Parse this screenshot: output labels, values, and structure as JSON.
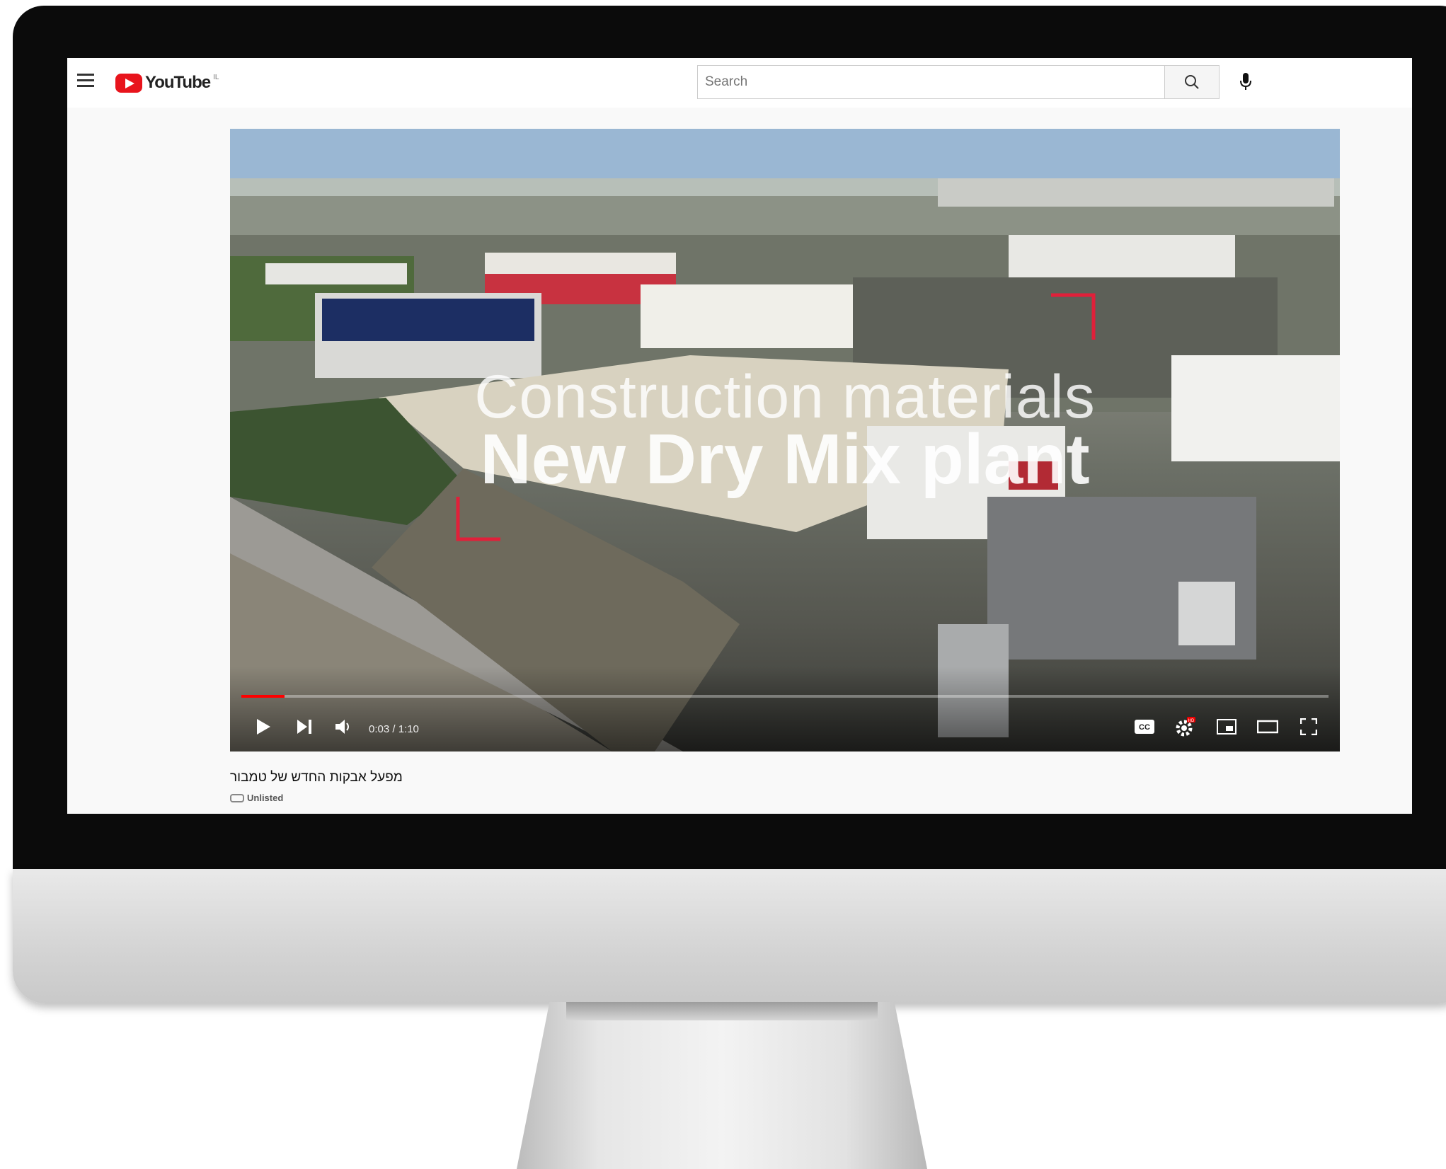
{
  "header": {
    "brand": "YouTube",
    "brand_country": "IL",
    "search_placeholder": "Search"
  },
  "video": {
    "overlay_line1": "Construction materials",
    "overlay_line2": "New Dry Mix plant",
    "time": "0:03 / 1:10",
    "progress": 0.04,
    "settings_badge": "HD",
    "cc_label": "CC"
  },
  "info": {
    "title": "מפעל אבקות החדש של טמבור",
    "visibility": "Unlisted"
  },
  "colors": {
    "brand_red": "#e8141c",
    "progress_red": "#ff0000",
    "accent_red": "#e0203a"
  }
}
